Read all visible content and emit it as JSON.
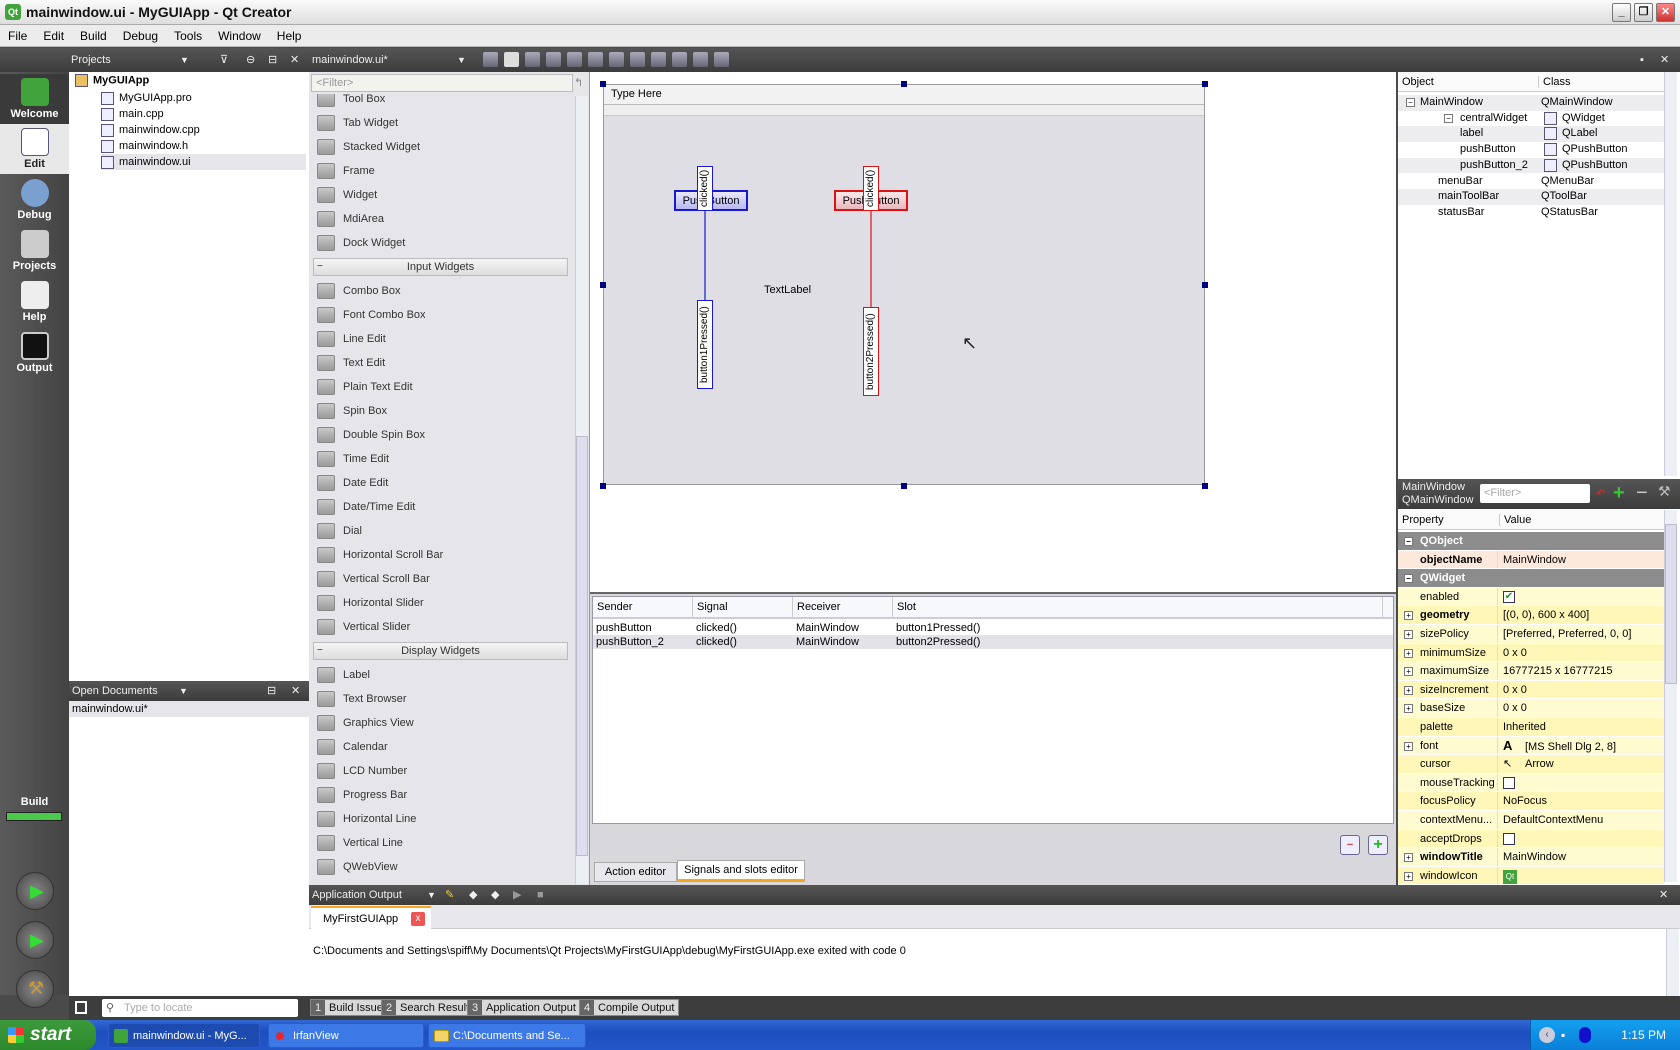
{
  "window": {
    "title": "mainwindow.ui - MyGUIApp - Qt Creator",
    "controls": [
      "_",
      "❐",
      "✕"
    ]
  },
  "menu": [
    "File",
    "Edit",
    "Build",
    "Debug",
    "Tools",
    "Window",
    "Help"
  ],
  "modes": [
    {
      "label": "Welcome",
      "icon": "qt-logo-icon"
    },
    {
      "label": "Edit",
      "icon": "edit-icon"
    },
    {
      "label": "Debug",
      "icon": "debug-icon"
    },
    {
      "label": "Projects",
      "icon": "projects-icon"
    },
    {
      "label": "Help",
      "icon": "help-book-icon"
    },
    {
      "label": "Output",
      "icon": "output-icon"
    }
  ],
  "build": {
    "label": "Build",
    "progress": 100,
    "color": "#4cc94c"
  },
  "projects": {
    "header": "Projects",
    "root": "MyGUIApp",
    "files": [
      {
        "name": "MyGUIApp.pro",
        "icon": "pro-file-icon"
      },
      {
        "name": "main.cpp",
        "icon": "cpp-file-icon"
      },
      {
        "name": "mainwindow.cpp",
        "icon": "cpp-file-icon"
      },
      {
        "name": "mainwindow.h",
        "icon": "h-file-icon"
      },
      {
        "name": "mainwindow.ui",
        "icon": "ui-file-icon",
        "selected": true
      }
    ]
  },
  "open_documents": {
    "header": "Open Documents",
    "items": [
      "mainwindow.ui*"
    ]
  },
  "editor": {
    "document": "mainwindow.ui*"
  },
  "widgetbox": {
    "filter_placeholder": "<Filter>",
    "items": [
      {
        "label": "Tool Box"
      },
      {
        "label": "Tab Widget"
      },
      {
        "label": "Stacked Widget"
      },
      {
        "label": "Frame"
      },
      {
        "label": "Widget"
      },
      {
        "label": "MdiArea"
      },
      {
        "label": "Dock Widget"
      },
      {
        "category": "Input Widgets"
      },
      {
        "label": "Combo Box"
      },
      {
        "label": "Font Combo Box"
      },
      {
        "label": "Line Edit"
      },
      {
        "label": "Text Edit"
      },
      {
        "label": "Plain Text Edit"
      },
      {
        "label": "Spin Box"
      },
      {
        "label": "Double Spin Box"
      },
      {
        "label": "Time Edit"
      },
      {
        "label": "Date Edit"
      },
      {
        "label": "Date/Time Edit"
      },
      {
        "label": "Dial"
      },
      {
        "label": "Horizontal Scroll Bar"
      },
      {
        "label": "Vertical Scroll Bar"
      },
      {
        "label": "Horizontal Slider"
      },
      {
        "label": "Vertical Slider"
      },
      {
        "category": "Display Widgets"
      },
      {
        "label": "Label"
      },
      {
        "label": "Text Browser"
      },
      {
        "label": "Graphics View"
      },
      {
        "label": "Calendar"
      },
      {
        "label": "LCD Number"
      },
      {
        "label": "Progress Bar"
      },
      {
        "label": "Horizontal Line"
      },
      {
        "label": "Vertical Line"
      },
      {
        "label": "QWebView"
      }
    ]
  },
  "form": {
    "menu_placeholder": "Type Here",
    "label_text": "TextLabel",
    "button1": {
      "text": "PushButton",
      "signal": "clicked()",
      "slot": "button1Pressed()",
      "color": "#1a1acc"
    },
    "button2": {
      "text": "PushButton",
      "signal": "clicked()",
      "slot": "button2Pressed()",
      "color": "#dd1111"
    }
  },
  "signals": {
    "headers": [
      "Sender",
      "Signal",
      "Receiver",
      "Slot"
    ],
    "rows": [
      [
        "pushButton",
        "clicked()",
        "MainWindow",
        "button1Pressed()"
      ],
      [
        "pushButton_2",
        "clicked()",
        "MainWindow",
        "button2Pressed()"
      ]
    ],
    "tabs": [
      "Action editor",
      "Signals and slots editor"
    ],
    "active_tab": 1
  },
  "object_inspector": {
    "headers": [
      "Object",
      "Class"
    ],
    "rows": [
      {
        "object": "MainWindow",
        "class": "QMainWindow",
        "depth": 0
      },
      {
        "object": "centralWidget",
        "class": "QWidget",
        "depth": 1
      },
      {
        "object": "label",
        "class": "QLabel",
        "depth": 2
      },
      {
        "object": "pushButton",
        "class": "QPushButton",
        "depth": 2
      },
      {
        "object": "pushButton_2",
        "class": "QPushButton",
        "depth": 2
      },
      {
        "object": "menuBar",
        "class": "QMenuBar",
        "depth": 1
      },
      {
        "object": "mainToolBar",
        "class": "QToolBar",
        "depth": 1
      },
      {
        "object": "statusBar",
        "class": "QStatusBar",
        "depth": 1
      }
    ]
  },
  "property_editor": {
    "object": "MainWindow",
    "class": "QMainWindow",
    "filter_placeholder": "<Filter>",
    "headers": [
      "Property",
      "Value"
    ],
    "rows": [
      {
        "name": "QObject",
        "group": true
      },
      {
        "name": "objectName",
        "value": "MainWindow",
        "bold": true
      },
      {
        "name": "QWidget",
        "group": true
      },
      {
        "name": "enabled",
        "checkbox": true,
        "checked": true
      },
      {
        "name": "geometry",
        "value": "[(0, 0), 600 x 400]",
        "bold": true,
        "expand": true
      },
      {
        "name": "sizePolicy",
        "value": "[Preferred, Preferred, 0, 0]",
        "expand": true
      },
      {
        "name": "minimumSize",
        "value": "0 x 0",
        "expand": true
      },
      {
        "name": "maximumSize",
        "value": "16777215 x 16777215",
        "expand": true
      },
      {
        "name": "sizeIncrement",
        "value": "0 x 0",
        "expand": true
      },
      {
        "name": "baseSize",
        "value": "0 x 0",
        "expand": true
      },
      {
        "name": "palette",
        "value": "Inherited"
      },
      {
        "name": "font",
        "value": "[MS Shell Dlg 2, 8]",
        "expand": true,
        "prefix": "A"
      },
      {
        "name": "cursor",
        "value": "Arrow",
        "prefix": "↖"
      },
      {
        "name": "mouseTracking",
        "checkbox": true,
        "checked": false
      },
      {
        "name": "focusPolicy",
        "value": "NoFocus"
      },
      {
        "name": "contextMenu...",
        "value": "DefaultContextMenu"
      },
      {
        "name": "acceptDrops",
        "checkbox": true,
        "checked": false
      },
      {
        "name": "windowTitle",
        "value": "MainWindow",
        "bold": true,
        "expand": true
      },
      {
        "name": "windowIcon",
        "value": "",
        "expand": true,
        "prefix": "Qt"
      }
    ]
  },
  "output": {
    "header": "Application Output",
    "tab": "MyFirstGUIApp",
    "text": "C:\\Documents and Settings\\spiff\\My Documents\\Qt Projects\\MyFirstGUIApp\\debug\\MyFirstGUIApp.exe exited with code 0"
  },
  "statusbar": {
    "locate_placeholder": "Type to locate",
    "buttons": [
      {
        "n": "1",
        "label": "Build Issues"
      },
      {
        "n": "2",
        "label": "Search Results"
      },
      {
        "n": "3",
        "label": "Application Output"
      },
      {
        "n": "4",
        "label": "Compile Output"
      }
    ]
  },
  "taskbar": {
    "start": "start",
    "tasks": [
      "mainwindow.ui - MyG...",
      "IrfanView",
      "C:\\Documents and Se..."
    ],
    "clock": "1:15 PM"
  }
}
